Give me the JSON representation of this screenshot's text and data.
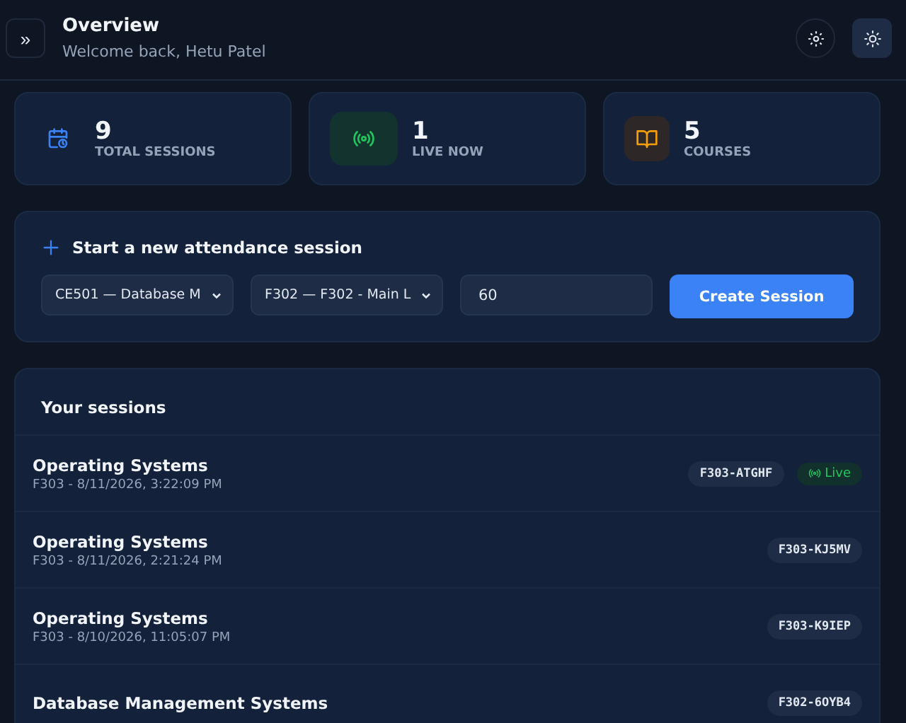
{
  "header": {
    "sidebar_toggle": "»",
    "title": "Overview",
    "subtitle": "Welcome back, Hetu Patel"
  },
  "stats": [
    {
      "kind": "sessions",
      "value": "9",
      "label": "TOTAL SESSIONS"
    },
    {
      "kind": "live",
      "value": "1",
      "label": "LIVE NOW"
    },
    {
      "kind": "courses",
      "value": "5",
      "label": "COURSES"
    }
  ],
  "new_session": {
    "title": "Start a new attendance session",
    "course": "CE501 — Database M",
    "room": "F302 — F302 - Main L",
    "duration": "60",
    "button": "Create Session"
  },
  "sessions": {
    "title": "Your sessions",
    "rows": [
      {
        "name": "Operating Systems",
        "meta": "F303 - 8/11/2026, 3:22:09 PM",
        "code": "F303-ATGHF",
        "live": true,
        "live_label": "Live"
      },
      {
        "name": "Operating Systems",
        "meta": "F303 - 8/11/2026, 2:21:24 PM",
        "code": "F303-KJ5MV",
        "live": false
      },
      {
        "name": "Operating Systems",
        "meta": "F303 - 8/10/2026, 11:05:07 PM",
        "code": "F303-K9IEP",
        "live": false
      },
      {
        "name": "Database Management Systems",
        "code": "F302-6OYB4",
        "live": false
      }
    ]
  }
}
